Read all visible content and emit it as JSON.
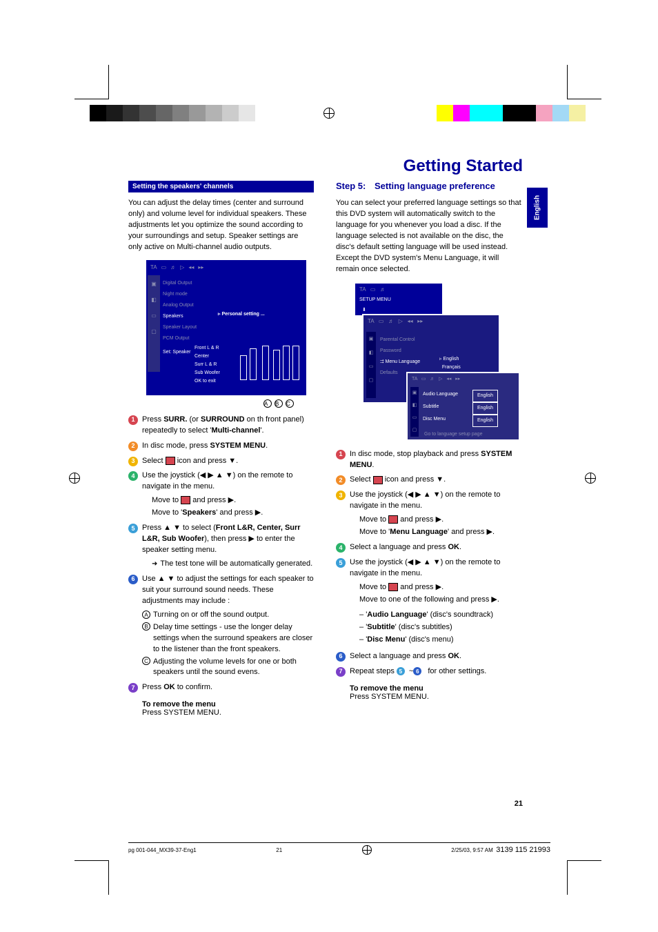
{
  "page_title": "Getting Started",
  "language_tab": "English",
  "page_number": "21",
  "left": {
    "section_header": "Setting the speakers' channels",
    "intro": "You can adjust the delay times (center and surround only) and volume level for individual speakers. These adjustments let you optimize the sound according to your surroundings and setup.  Speaker settings are only active on Multi-channel audio outputs.",
    "diagram": {
      "list": [
        "Digital Output",
        "Night mode",
        "Analog Output",
        "Speakers",
        "Speaker Layout",
        "PCM Output",
        "Set: Speaker"
      ],
      "active_item": "Speakers",
      "personal_setting": "Personal setting ...",
      "sublist": [
        "Front L & R",
        "Center",
        "Surr L & R",
        "Sub Woofer",
        "OK to exit"
      ],
      "abc": [
        "A",
        "B",
        "C"
      ]
    },
    "steps": {
      "1": {
        "pre": "Press ",
        "b1": "SURR.",
        "mid": " (or ",
        "b2": "SURROUND",
        "mid2": " on th",
        "b3": "",
        "rest": " front panel) repeatedly to select '",
        "b4": "Multi-channel",
        "end": "'."
      },
      "2": {
        "pre": "In disc mode, press ",
        "b": "SYSTEM MENU",
        "end": "."
      },
      "3": {
        "pre": "Select ",
        "post": " icon and press ▼."
      },
      "4": {
        "text": "Use the joystick (◀ ▶ ▲ ▼) on the remote to navigate in the menu.",
        "sub1_pre": "Move to ",
        "sub1_post": " and press ▶.",
        "sub2_pre": "Move to '",
        "sub2_b": "Speakers",
        "sub2_post": "' and press ▶."
      },
      "5": {
        "pre": "Press ▲ ▼ to select (",
        "b": "Front L&R, Center, Surr L&R, Sub Woofer",
        "mid": "), then press ▶ to enter the speaker setting menu.",
        "arrow": "The test tone will be automatically generated."
      },
      "6": {
        "text": "Use ▲ ▼ to adjust the settings for each speaker to suit your surround sound needs. These adjustments may include :",
        "a": "Turning on or off the sound output.",
        "b": "Delay time settings - use the longer delay settings when the surround speakers are closer to the listener than the front speakers.",
        "c": "Adjusting the volume levels for one or both speakers until the sound evens."
      },
      "7": {
        "pre": "Press ",
        "b": "OK",
        "end": " to confirm."
      }
    },
    "remove_title": "To remove the menu",
    "remove_text": "Press SYSTEM MENU."
  },
  "right": {
    "step_num": "Step 5:",
    "step_title": "Setting language preference",
    "intro": "You can select your preferred language settings so that this DVD system will automatically switch to the language for you whenever you load a disc.  If the language selected is not available on the disc, the disc's default setting language will be used instead.  Except the DVD system's Menu Language, it will remain once selected.",
    "diagram": {
      "layer1_title": "SETUP MENU",
      "layer2_list": [
        "Parental Control",
        "Password",
        "Menu Language",
        "Defaults"
      ],
      "layer2_active": "Menu Language",
      "layer2_langs": [
        "English",
        "Français"
      ],
      "layer3_rows": [
        "Audio Language",
        "Subtitle",
        "Disc Menu"
      ],
      "layer3_value": "English",
      "layer3_hint": "Go to language setup page"
    },
    "steps": {
      "1": {
        "pre": "In disc mode, stop playback and press ",
        "b": "SYSTEM MENU",
        "end": "."
      },
      "2": {
        "pre": "Select ",
        "post": " icon and press ▼."
      },
      "3": {
        "text": "Use the joystick (◀ ▶ ▲ ▼) on the remote to navigate in the menu.",
        "sub1_pre": "Move to ",
        "sub1_post": " and press ▶.",
        "sub2_pre": "Move to '",
        "sub2_b": "Menu Language",
        "sub2_post": "' and press ▶."
      },
      "4": {
        "pre": "Select a language and press ",
        "b": "OK",
        "end": "."
      },
      "5": {
        "text": "Use the joystick (◀ ▶ ▲ ▼) on the remote to navigate in the menu.",
        "sub1_pre": "Move to ",
        "sub1_post": " and press ▶.",
        "sub2": "Move to one of the following and press ▶.",
        "dashA_pre": "'",
        "dashA_b": "Audio Language",
        "dashA_post": "' (disc's soundtrack)",
        "dashB_pre": "'",
        "dashB_b": "Subtitle",
        "dashB_post": "' (disc's subtitles)",
        "dashC_pre": "'",
        "dashC_b": "Disc Menu",
        "dashC_post": "' (disc's menu)"
      },
      "6": {
        "pre": "Select a language and press ",
        "b": "OK",
        "end": "."
      },
      "7": {
        "pre": "Repeat steps ",
        "b5": "5",
        "mid": "~",
        "b6": "6",
        "end": " for other settings."
      }
    },
    "remove_title": "To remove the menu",
    "remove_text": "Press SYSTEM MENU."
  },
  "footer": {
    "left": "pg 001-044_MX39-37-Eng1",
    "center": "21",
    "right_date": "2/25/03, 9:57 AM",
    "right_code": "3139 115 21993"
  },
  "colors": {
    "bullets": [
      "#d64550",
      "#f28c28",
      "#f0b400",
      "#2bb36a",
      "#3a9fd8",
      "#2a5cc8",
      "#7a3fc8"
    ]
  }
}
